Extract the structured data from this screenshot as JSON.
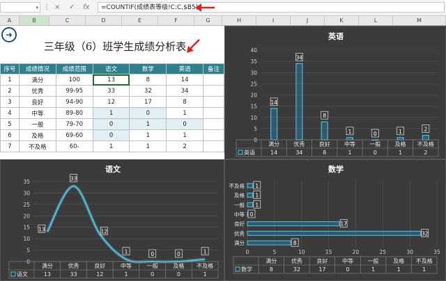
{
  "formula_bar": {
    "name_box": "",
    "cancel_icon": "×",
    "enter_icon": "✓",
    "fx_label": "fx",
    "formula": "=COUNTIF(成绩表等级!C:C,$B5)"
  },
  "columns": [
    "A",
    "B",
    "C",
    "D",
    "E",
    "F",
    "G",
    "H",
    "I",
    "J",
    "K",
    "L",
    "M"
  ],
  "selected_column": "B",
  "sheet": {
    "title": "三年级（6）班学生成绩分析表",
    "headers": [
      "序号",
      "成绩情况",
      "成绩范围",
      "语文",
      "数学",
      "英语",
      "备注"
    ],
    "rows": [
      [
        "1",
        "满分",
        "100",
        "13",
        "8",
        "14",
        ""
      ],
      [
        "2",
        "优秀",
        "99-95",
        "33",
        "32",
        "34",
        ""
      ],
      [
        "3",
        "良好",
        "94-90",
        "12",
        "17",
        "8",
        ""
      ],
      [
        "4",
        "中等",
        "89-80",
        "1",
        "0",
        "1",
        ""
      ],
      [
        "5",
        "一般",
        "79-70",
        "0",
        "1",
        "0",
        ""
      ],
      [
        "6",
        "及格",
        "69-60",
        "0",
        "1",
        "1",
        ""
      ],
      [
        "7",
        "不及格",
        "60-",
        "1",
        "1",
        "2",
        ""
      ]
    ]
  },
  "colors": {
    "panel_bg": "#3b3b3b",
    "accent": "#4fc3e8",
    "header_teal": "#2f7f8f",
    "arrow": "#e02020"
  },
  "chart_data": [
    {
      "type": "bar",
      "title": "英语",
      "categories": [
        "满分",
        "优秀",
        "良好",
        "中等",
        "一般",
        "及格",
        "不及格"
      ],
      "series": [
        {
          "name": "英语",
          "values": [
            14,
            34,
            8,
            1,
            0,
            1,
            2
          ]
        }
      ],
      "ylim": [
        0,
        40
      ],
      "yticks": [
        0,
        5,
        10,
        15,
        20,
        25,
        30,
        35,
        40
      ],
      "grid": true,
      "legend": "data-table"
    },
    {
      "type": "line",
      "title": "语文",
      "categories": [
        "满分",
        "优秀",
        "良好",
        "中等",
        "一般",
        "及格",
        "不及格"
      ],
      "series": [
        {
          "name": "语文",
          "values": [
            13,
            33,
            12,
            1,
            0,
            0,
            1
          ]
        }
      ],
      "ylim": [
        0,
        35
      ],
      "yticks": [
        0,
        5,
        10,
        15,
        20,
        25,
        30,
        35
      ],
      "grid": true,
      "legend": "data-table"
    },
    {
      "type": "bar",
      "orientation": "horizontal",
      "title": "数学",
      "categories": [
        "满分",
        "优秀",
        "良好",
        "中等",
        "一般",
        "及格",
        "不及格"
      ],
      "series": [
        {
          "name": "数学",
          "values": [
            8,
            32,
            17,
            0,
            1,
            1,
            1
          ]
        }
      ],
      "xlim": [
        0,
        35
      ],
      "xticks": [
        0,
        5,
        10,
        15,
        20,
        25,
        30,
        35
      ],
      "grid": true,
      "legend": "data-table"
    }
  ]
}
